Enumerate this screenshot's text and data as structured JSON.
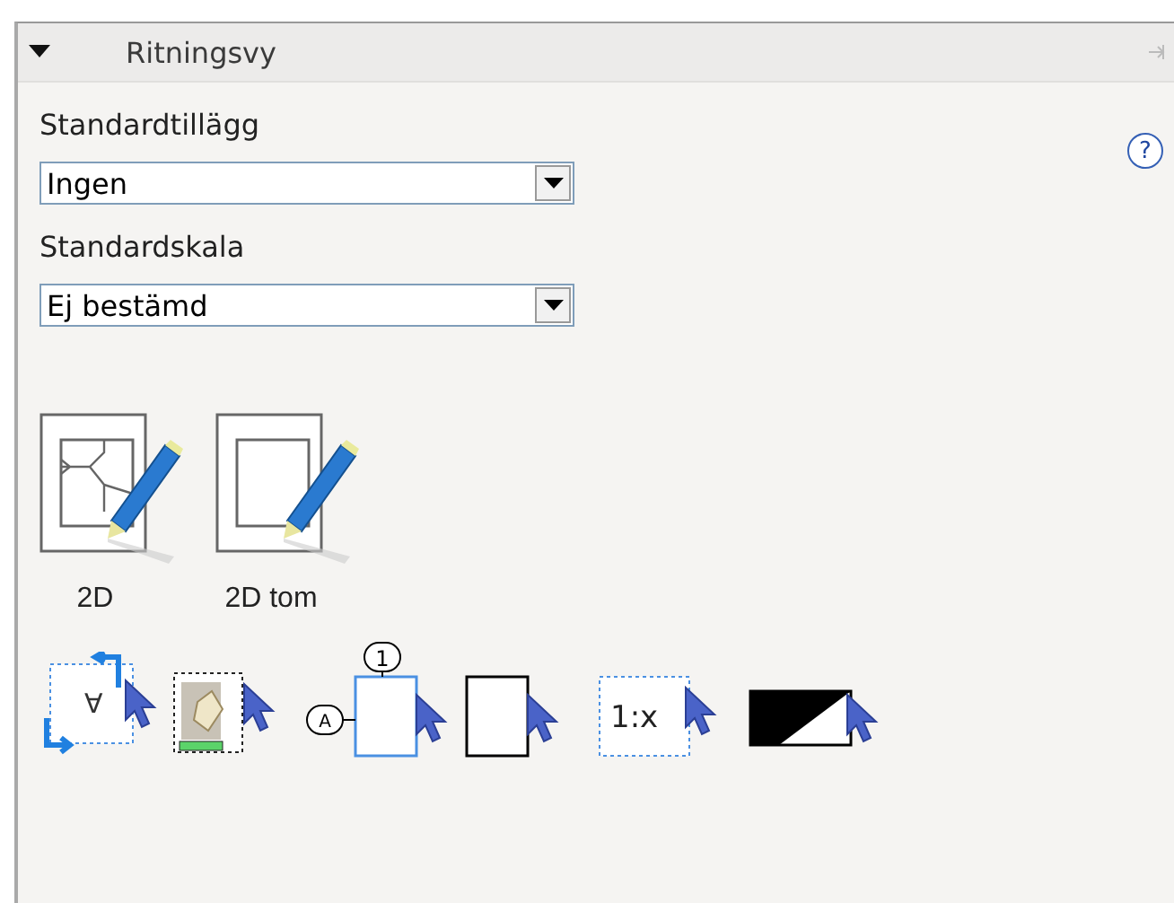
{
  "panel": {
    "title": "Ritningsvy",
    "expanded": true
  },
  "help": {
    "label": "?"
  },
  "fields": [
    {
      "label": "Standardtillägg",
      "value": "Ingen"
    },
    {
      "label": "Standardskala",
      "value": "Ej bestämd"
    }
  ],
  "views": [
    {
      "kind": "plan",
      "label": "2D"
    },
    {
      "kind": "blank",
      "label": "2D tom"
    }
  ],
  "tools": [
    {
      "kind": "rotate",
      "text": "∀"
    },
    {
      "kind": "image"
    },
    {
      "kind": "balloon",
      "text": "1",
      "side_text": "A"
    },
    {
      "kind": "frame"
    },
    {
      "kind": "scale",
      "text": "1:x"
    },
    {
      "kind": "fill"
    }
  ]
}
